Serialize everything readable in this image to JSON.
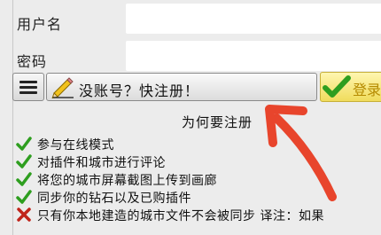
{
  "login_form": {
    "username_label": "用户名",
    "username_value": "",
    "password_label": "密码",
    "password_value": ""
  },
  "toolbar": {
    "menu_icon": "hamburger-menu-icon",
    "register_icon": "pencil-icon",
    "register_label": "没账号？快注册！",
    "login_icon": "checkmark-icon",
    "login_label": "登录"
  },
  "why_register": {
    "heading": "为何要注册",
    "benefits": [
      {
        "icon": "checkmark-icon",
        "text": "参与在线模式"
      },
      {
        "icon": "checkmark-icon",
        "text": "对插件和城市进行评论"
      },
      {
        "icon": "checkmark-icon",
        "text": "将您的城市屏幕截图上传到画廊"
      },
      {
        "icon": "checkmark-icon",
        "text": "同步你的钻石以及已购插件"
      },
      {
        "icon": "cross-icon",
        "text": "只有你本地建造的城市文件不会被同步 译注：如果"
      }
    ]
  },
  "colors": {
    "check_green": "#2e9e1f",
    "cross_red": "#c0241b",
    "login_bg": "#f0dc5c",
    "login_text": "#b58a00",
    "annotation_arrow": "#e8452c"
  }
}
